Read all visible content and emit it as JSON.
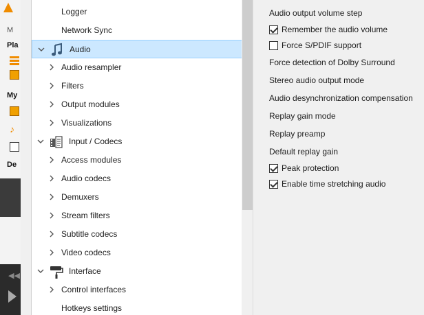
{
  "background_window": {
    "labels": [
      "M",
      "Pla",
      "My",
      "De"
    ]
  },
  "tree": {
    "items": [
      {
        "label": "Logger",
        "level": 2,
        "chevron": "none",
        "icon": ""
      },
      {
        "label": "Network Sync",
        "level": 2,
        "chevron": "none",
        "icon": ""
      },
      {
        "label": "Audio",
        "level": 1,
        "chevron": "down",
        "icon": "audio-note-icon",
        "selected": true
      },
      {
        "label": "Audio resampler",
        "level": 2,
        "chevron": "right",
        "icon": ""
      },
      {
        "label": "Filters",
        "level": 2,
        "chevron": "right",
        "icon": ""
      },
      {
        "label": "Output modules",
        "level": 2,
        "chevron": "right",
        "icon": ""
      },
      {
        "label": "Visualizations",
        "level": 2,
        "chevron": "right",
        "icon": ""
      },
      {
        "label": "Input / Codecs",
        "level": 1,
        "chevron": "down",
        "icon": "input-codecs-icon"
      },
      {
        "label": "Access modules",
        "level": 2,
        "chevron": "right",
        "icon": ""
      },
      {
        "label": "Audio codecs",
        "level": 2,
        "chevron": "right",
        "icon": ""
      },
      {
        "label": "Demuxers",
        "level": 2,
        "chevron": "right",
        "icon": ""
      },
      {
        "label": "Stream filters",
        "level": 2,
        "chevron": "right",
        "icon": ""
      },
      {
        "label": "Subtitle codecs",
        "level": 2,
        "chevron": "right",
        "icon": ""
      },
      {
        "label": "Video codecs",
        "level": 2,
        "chevron": "right",
        "icon": ""
      },
      {
        "label": "Interface",
        "level": 1,
        "chevron": "down",
        "icon": "paint-roller-icon"
      },
      {
        "label": "Control interfaces",
        "level": 2,
        "chevron": "right",
        "icon": ""
      },
      {
        "label": "Hotkeys settings",
        "level": 2,
        "chevron": "none",
        "icon": ""
      }
    ]
  },
  "panel": {
    "options": [
      {
        "label": "Audio output volume step",
        "type": "label"
      },
      {
        "label": "Remember the audio volume",
        "type": "checkbox",
        "checked": true
      },
      {
        "label": "Force S/PDIF support",
        "type": "checkbox",
        "checked": false
      },
      {
        "label": "Force detection of Dolby Surround",
        "type": "label"
      },
      {
        "label": "Stereo audio output mode",
        "type": "label"
      },
      {
        "label": "Audio desynchronization compensation",
        "type": "label"
      },
      {
        "label": "Replay gain mode",
        "type": "label"
      },
      {
        "label": "Replay preamp",
        "type": "label"
      },
      {
        "label": "Default replay gain",
        "type": "label"
      },
      {
        "label": "Peak protection",
        "type": "checkbox",
        "checked": true
      },
      {
        "label": "Enable time stretching audio",
        "type": "checkbox",
        "checked": true
      }
    ]
  },
  "colors": {
    "selection_bg": "#cce8ff",
    "selection_border": "#99d1ff",
    "vlc_orange": "#f08c00"
  }
}
